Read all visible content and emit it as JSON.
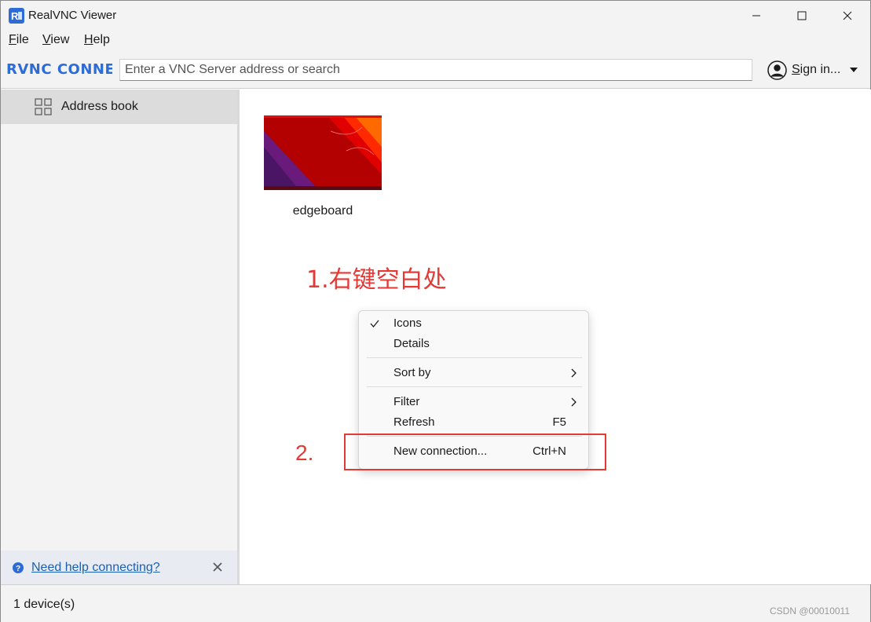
{
  "window": {
    "title": "RealVNC Viewer"
  },
  "menubar": {
    "items": [
      "File",
      "View",
      "Help"
    ]
  },
  "toolbar": {
    "brand": "RVNC CONNECT",
    "search_placeholder": "Enter a VNC Server address or search",
    "signin_label": "Sign in..."
  },
  "sidebar": {
    "items": [
      {
        "label": "Address book",
        "icon": "grid-icon"
      }
    ],
    "help_link": "Need help connecting?"
  },
  "main": {
    "devices": [
      {
        "name": "edgeboard"
      }
    ]
  },
  "annotations": {
    "step1": "1.右键空白处",
    "step2": "2.",
    "highlight_color": "#e53935"
  },
  "context_menu": {
    "items": [
      {
        "label": "Icons",
        "checked": true
      },
      {
        "label": "Details"
      },
      {
        "label": "Sort by",
        "submenu": true
      },
      {
        "label": "Filter",
        "submenu": true
      },
      {
        "label": "Refresh",
        "shortcut": "F5"
      },
      {
        "label": "New connection...",
        "shortcut": "Ctrl+N"
      }
    ]
  },
  "statusbar": {
    "text": "1 device(s)",
    "watermark": "CSDN @00010011"
  }
}
